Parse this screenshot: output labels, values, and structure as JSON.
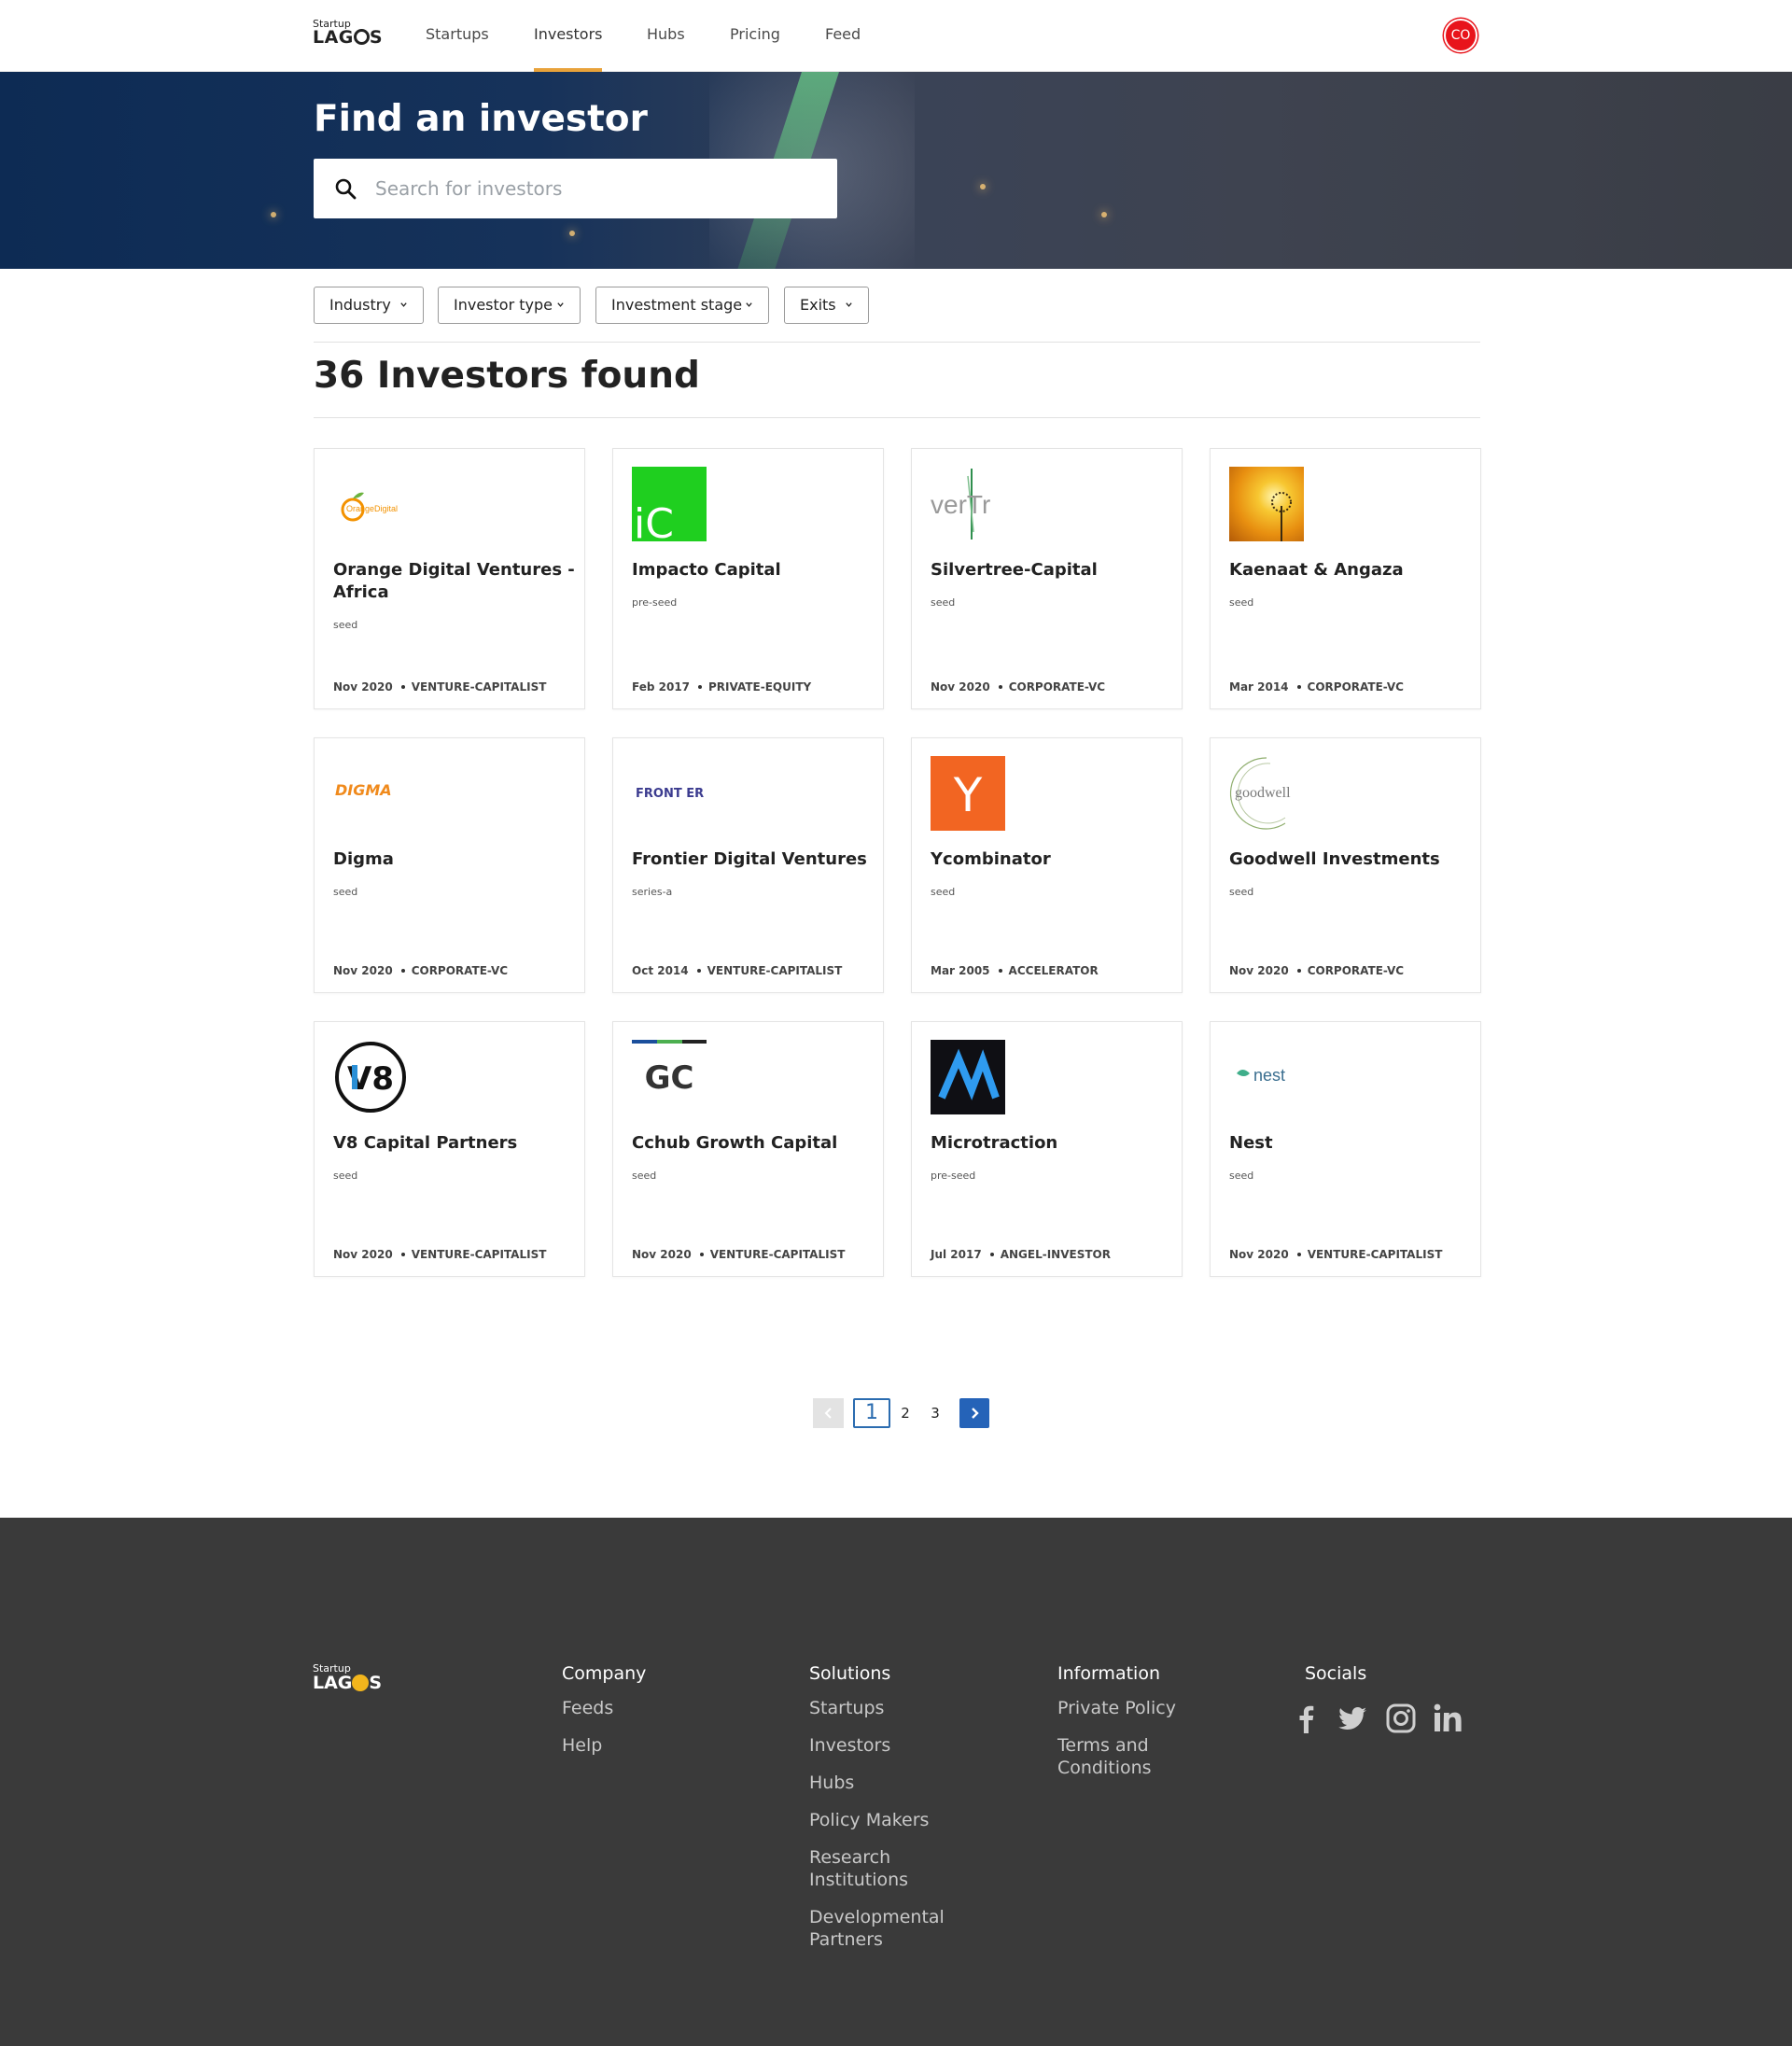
{
  "nav": {
    "logo": {
      "top": "Startup",
      "bottom_left": "LAG",
      "bottom_right": "S"
    },
    "items": [
      {
        "label": "Startups",
        "active": false
      },
      {
        "label": "Investors",
        "active": true
      },
      {
        "label": "Hubs",
        "active": false
      },
      {
        "label": "Pricing",
        "active": false
      },
      {
        "label": "Feed",
        "active": false
      }
    ],
    "avatar": "CO"
  },
  "hero": {
    "title": "Find an investor",
    "search_placeholder": "Search for investors"
  },
  "filters": [
    {
      "label": "Industry"
    },
    {
      "label": "Investor type"
    },
    {
      "label": "Investment stage"
    },
    {
      "label": "Exits"
    }
  ],
  "results": {
    "count_label": "36 Investors found"
  },
  "investors": [
    {
      "name": "Orange Digital Ventures - Africa",
      "stage": "seed",
      "date": "Nov 2020",
      "type": "VENTURE-CAPITALIST",
      "logo": "orange-digital-logo",
      "logo_text": "OrangeDigital"
    },
    {
      "name": "Impacto Capital",
      "stage": "pre-seed",
      "date": "Feb 2017",
      "type": "PRIVATE-EQUITY",
      "logo": "impacto-logo",
      "logo_text": "iC"
    },
    {
      "name": "Silvertree-Capital",
      "stage": "seed",
      "date": "Nov 2020",
      "type": "CORPORATE-VC",
      "logo": "silvertree-logo",
      "logo_text": "verTr"
    },
    {
      "name": "Kaenaat & Angaza",
      "stage": "seed",
      "date": "Mar 2014",
      "type": "CORPORATE-VC",
      "logo": "kaenaat-logo",
      "logo_text": ""
    },
    {
      "name": "Digma",
      "stage": "seed",
      "date": "Nov 2020",
      "type": "CORPORATE-VC",
      "logo": "digma-logo",
      "logo_text": "DIGMA"
    },
    {
      "name": "Frontier Digital Ventures",
      "stage": "series-a",
      "date": "Oct 2014",
      "type": "VENTURE-CAPITALIST",
      "logo": "frontier-logo",
      "logo_text": "FRONT ER"
    },
    {
      "name": "Ycombinator",
      "stage": "seed",
      "date": "Mar 2005",
      "type": "ACCELERATOR",
      "logo": "ycombinator-logo",
      "logo_text": "Y"
    },
    {
      "name": "Goodwell Investments",
      "stage": "seed",
      "date": "Nov 2020",
      "type": "CORPORATE-VC",
      "logo": "goodwell-logo",
      "logo_text": "goodwell"
    },
    {
      "name": "V8 Capital Partners",
      "stage": "seed",
      "date": "Nov 2020",
      "type": "VENTURE-CAPITALIST",
      "logo": "v8-logo",
      "logo_text": "V8"
    },
    {
      "name": "Cchub Growth Capital",
      "stage": "seed",
      "date": "Nov 2020",
      "type": "VENTURE-CAPITALIST",
      "logo": "gc-fund-logo",
      "logo_text": "GC"
    },
    {
      "name": "Microtraction",
      "stage": "pre-seed",
      "date": "Jul 2017",
      "type": "ANGEL-INVESTOR",
      "logo": "microtraction-logo",
      "logo_text": "M"
    },
    {
      "name": "Nest",
      "stage": "seed",
      "date": "Nov 2020",
      "type": "VENTURE-CAPITALIST",
      "logo": "nest-logo",
      "logo_text": "nest"
    }
  ],
  "pagination": {
    "pages": [
      "1",
      "2",
      "3"
    ],
    "current": "1",
    "prev_icon": "chevron-left-icon",
    "next_icon": "chevron-right-icon"
  },
  "footer": {
    "logo": {
      "top": "Startup",
      "bottom_left": "LAG",
      "bottom_right": "S"
    },
    "columns": [
      {
        "title": "Company",
        "links": [
          "Feeds",
          "Help"
        ]
      },
      {
        "title": "Solutions",
        "links": [
          "Startups",
          "Investors",
          "Hubs",
          "Policy Makers",
          "Research Institutions",
          "Developmental Partners"
        ]
      },
      {
        "title": "Information",
        "links": [
          "Private Policy",
          "Terms and Conditions"
        ]
      }
    ],
    "socials_title": "Socials",
    "socials": [
      "facebook-icon",
      "twitter-icon",
      "instagram-icon",
      "linkedin-icon"
    ]
  },
  "colors": {
    "accent": "#e8a23a",
    "avatar": "#e8141b",
    "pager": "#2563b8",
    "footer_bg": "#3a3a3a",
    "hero_bg": "#0d2b54"
  }
}
